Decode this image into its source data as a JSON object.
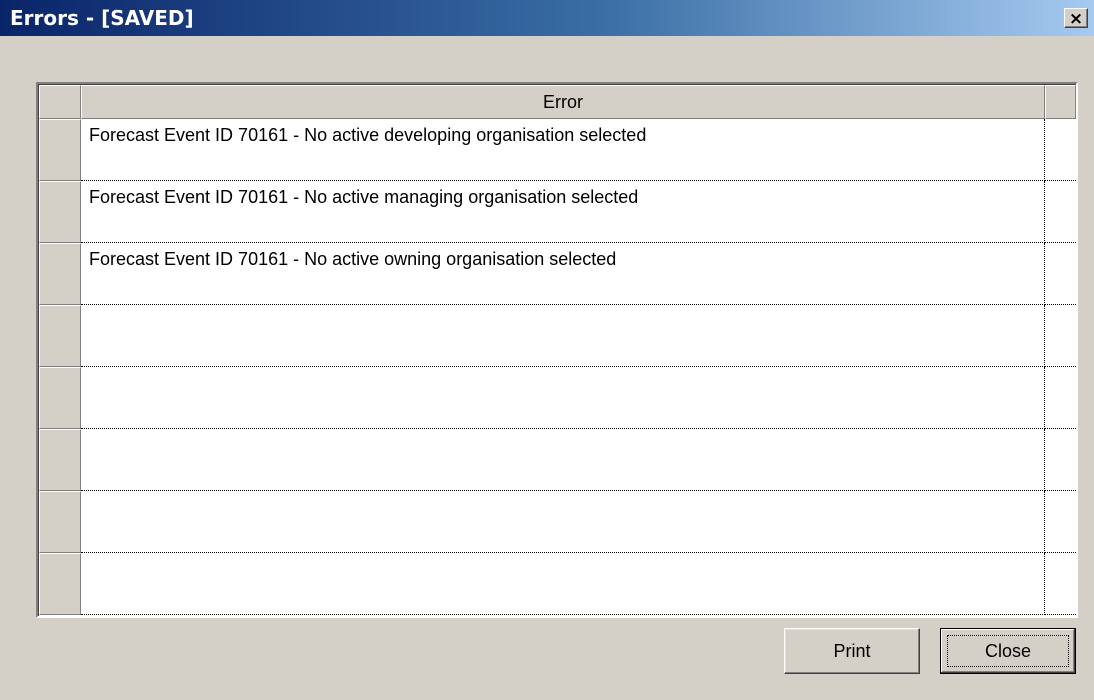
{
  "window": {
    "title": "Errors - [SAVED]",
    "close_glyph": "×"
  },
  "grid": {
    "columns": [
      "Error"
    ],
    "rows": [
      "Forecast Event ID 70161 -  No active developing organisation selected",
      "Forecast Event ID 70161 -  No active managing organisation selected",
      "Forecast Event ID 70161 -  No active owning organisation selected",
      "",
      "",
      "",
      "",
      ""
    ]
  },
  "buttons": {
    "print_label": "Print",
    "close_label": "Close"
  },
  "colors": {
    "face": "#d4d0c8",
    "title_start": "#0a246a",
    "title_end": "#a6caf0"
  }
}
